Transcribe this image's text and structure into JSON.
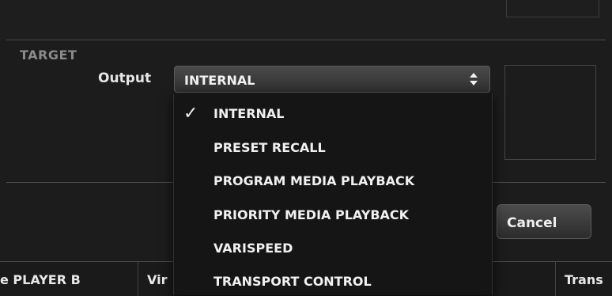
{
  "target": {
    "section_label": "TARGET",
    "output_label": "Output",
    "output_value": "INTERNAL",
    "options": [
      {
        "label": "INTERNAL",
        "selected": true
      },
      {
        "label": "PRESET RECALL",
        "selected": false
      },
      {
        "label": "PROGRAM MEDIA PLAYBACK",
        "selected": false
      },
      {
        "label": "PRIORITY MEDIA PLAYBACK",
        "selected": false
      },
      {
        "label": "VARISPEED",
        "selected": false
      },
      {
        "label": "TRANSPORT CONTROL",
        "selected": false
      }
    ]
  },
  "dialog": {
    "cancel_label": "Cancel"
  },
  "bottom_columns": {
    "col1": "e PLAYER B",
    "col2": "Vir",
    "col3": "Trans"
  },
  "icons": {
    "checkmark": "checkmark-icon",
    "select_arrows": "up-down-arrows-icon"
  }
}
